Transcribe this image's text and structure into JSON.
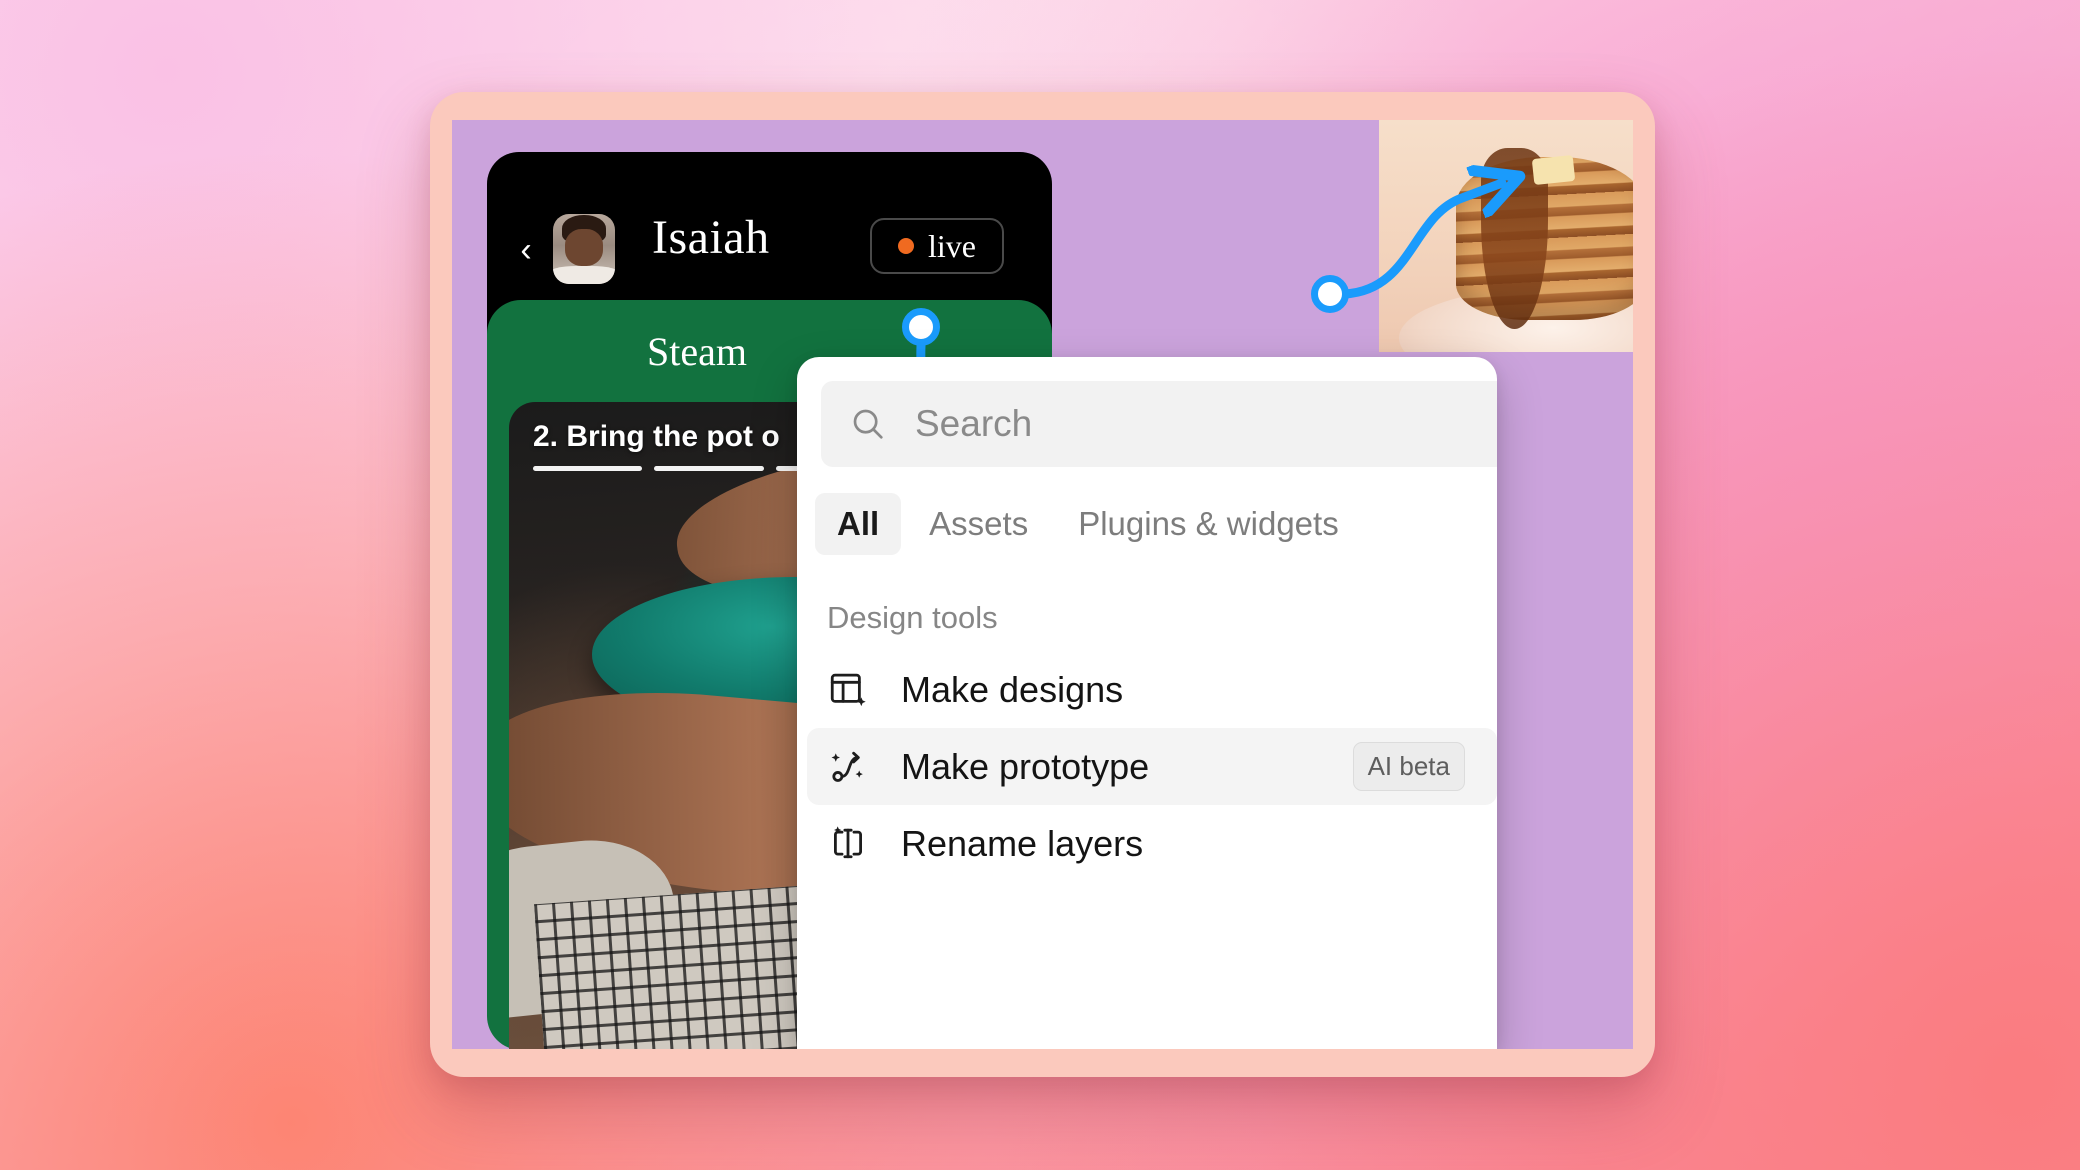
{
  "canvas": {
    "artboard_bg": "#cba3dc",
    "frame_border": "#fbc9bd",
    "accent_blue": "#1a9bfc"
  },
  "phone_mock": {
    "back_icon": "‹",
    "user_name": "Isaiah",
    "live_label": "live",
    "live_dot_color": "#f06a20"
  },
  "green_card": {
    "title": "Steam",
    "step_caption": "2.  Bring the pot o",
    "progress_segments": 4
  },
  "panel": {
    "search": {
      "placeholder": "Search",
      "value": "",
      "icon": "search-icon"
    },
    "tabs": [
      {
        "label": "All",
        "active": true
      },
      {
        "label": "Assets",
        "active": false
      },
      {
        "label": "Plugins & widgets",
        "active": false
      }
    ],
    "section_title": "Design tools",
    "items": [
      {
        "label": "Make designs",
        "icon": "make-designs-icon",
        "badge": "",
        "selected": false
      },
      {
        "label": "Make prototype",
        "icon": "make-prototype-icon",
        "badge": "AI beta",
        "selected": true
      },
      {
        "label": "Rename layers",
        "icon": "rename-layers-icon",
        "badge": "",
        "selected": false
      }
    ]
  }
}
